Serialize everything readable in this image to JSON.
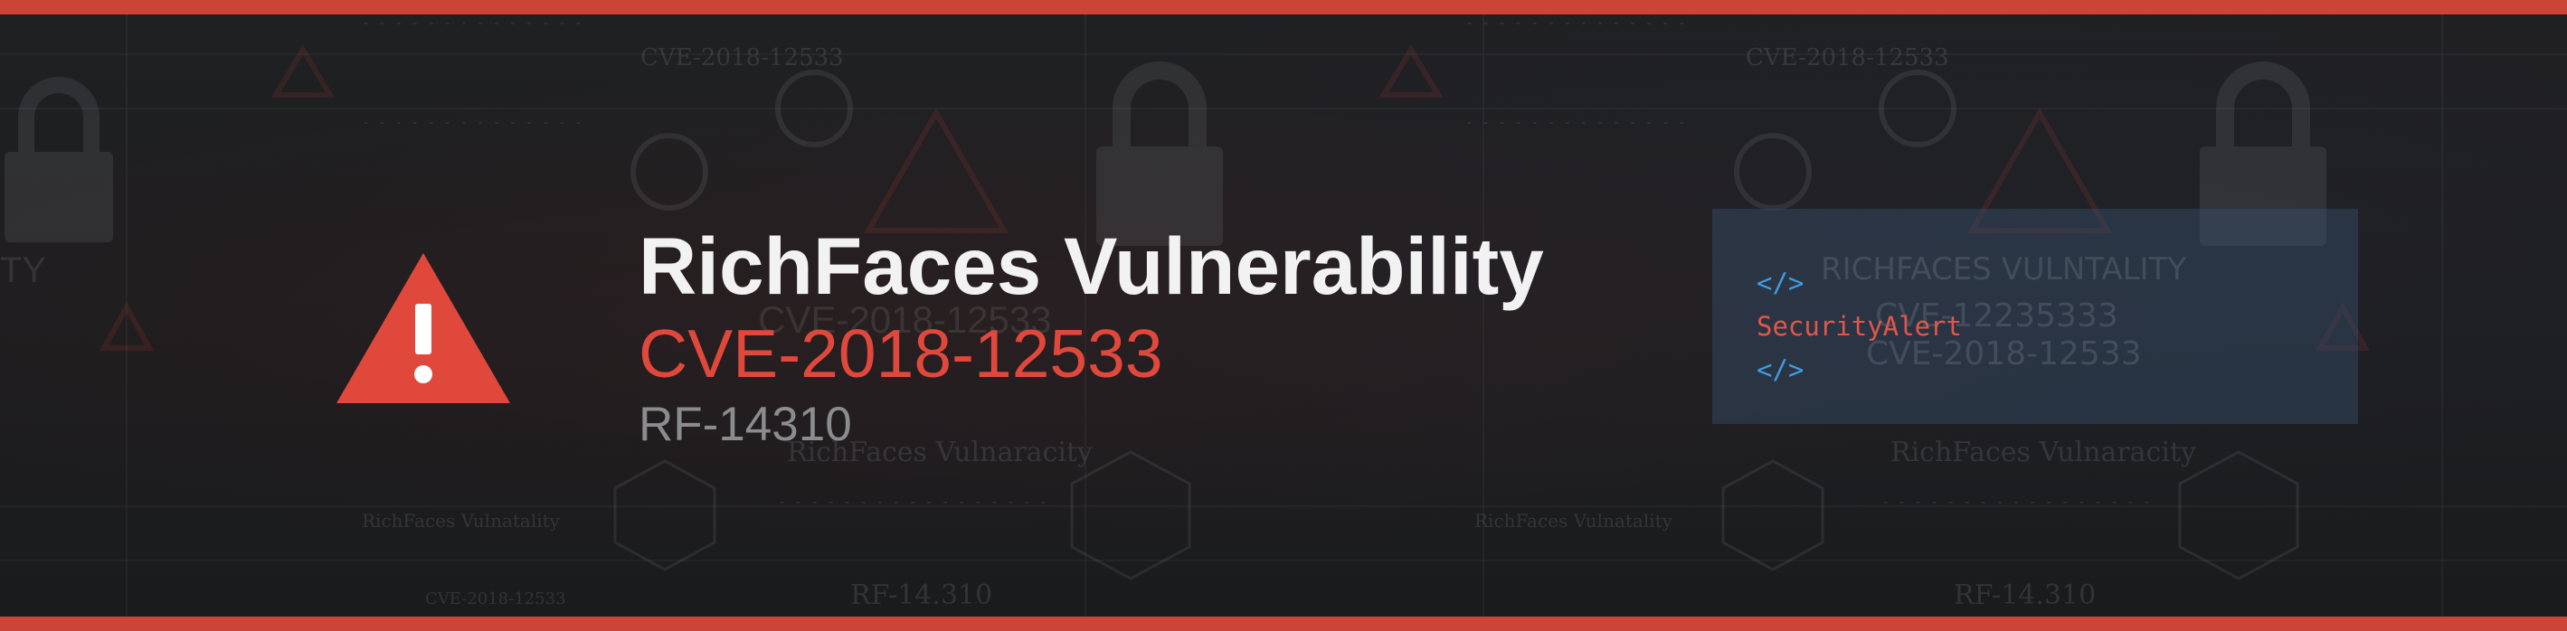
{
  "colors": {
    "accent_red": "#cc4338",
    "icon_red": "#e0483c",
    "code_tag_blue": "#3d9de0",
    "code_text_red": "#e0574a"
  },
  "banner": {
    "title": "RichFaces Vulnerability",
    "cve_id": "CVE-2018-12533",
    "rf_id": "RF-14310",
    "warning_icon": "warning-triangle-icon",
    "warning_mark": "!"
  },
  "code_card": {
    "open_tag": "</>",
    "text": "SecurityAlert",
    "close_tag": "</>"
  },
  "background_text": {
    "heading_left": "RichFaces Vulnaracity",
    "heading_card": "RICHFACES VULNTALITY",
    "cve_faint_1": "CVE-2018-12533",
    "cve_faint_2": "CVE-2018-12533",
    "cve_faint_3": "CVE-12235333",
    "cve_faint_4": "CVE-2018-12533",
    "rf_faint_1": "RF-14.310",
    "rf_faint_2": "RF-14.310",
    "lock_label": "RichFaces Vulnatality",
    "side_label_left": "TY"
  }
}
